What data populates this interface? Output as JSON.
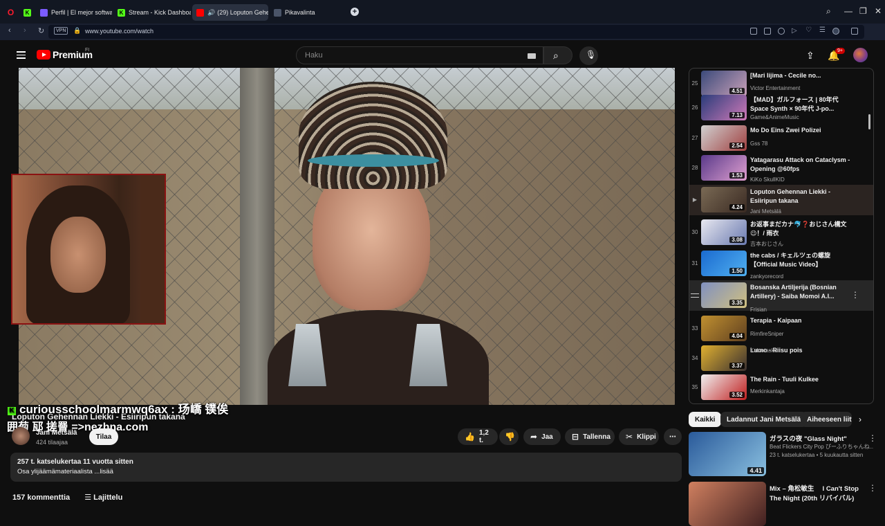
{
  "browser": {
    "tabs": [
      {
        "label": "",
        "fav_color": "#ff1b2d"
      },
      {
        "label": "",
        "fav_color": "#53fc18"
      },
      {
        "label": "Perfil | El mejor software p",
        "fav_color": "#7b5cff"
      },
      {
        "label": "Stream - Kick Dashboard",
        "fav_color": "#53fc18"
      },
      {
        "label": "(29) Loputon Gehenn",
        "fav_color": "#ff0000"
      },
      {
        "label": "Pikavalinta",
        "fav_color": "#8894a8"
      }
    ],
    "new_tab": "+",
    "url": "www.youtube.com/watch",
    "vpn": "VPN",
    "ai_label": "AI"
  },
  "youtube": {
    "brand": "Premium",
    "region": "FI",
    "search_placeholder": "Haku",
    "notif_count": "9+"
  },
  "overlay": {
    "chat_user": "curiousschoolmarmwq6ax",
    "chat_sep": " : ",
    "chat_text": "玚嶠 镤俟",
    "chat_line2": "囲菊 邷 搓罾 =>nezhna.com"
  },
  "video": {
    "title": "Loputon Gehennan Liekki - Esiiripun takana",
    "channel": "Jani Metsälä",
    "subscribers": "424 tilaajaa",
    "subscribe": "Tilaa",
    "likes": "1,2 t.",
    "share": "Jaa",
    "save": "Tallenna",
    "clip": "Klippi",
    "views_line": "257 t. katselukertaa  11 vuotta sitten",
    "desc_line": "Osa ylijäämämateriaalista ...lisää",
    "comments_label": "157 kommenttia",
    "sort_label": "Lajittelu"
  },
  "playlist": [
    {
      "idx": "25",
      "title": "[Mari Iijima - Cecile no...",
      "channel": "Victor Entertainment",
      "dur": "4.51",
      "colors": [
        "#3b4a7a",
        "#c9a0b8"
      ]
    },
    {
      "idx": "26",
      "title": "【MAD】ガルフォース | 80年代 Space Synth × 90年代 J-po...",
      "channel": "Game&AnimeMusic",
      "dur": "7.13",
      "colors": [
        "#2a3c7a",
        "#d07ab8"
      ]
    },
    {
      "idx": "27",
      "title": "Mo Do Eins Zwei Polizei",
      "channel": "Gss 78",
      "dur": "2.54",
      "colors": [
        "#d0d0d0",
        "#a04040"
      ]
    },
    {
      "idx": "28",
      "title": "Yatagarasu Attack on Cataclysm - Opening @60fps",
      "channel": "KiKo SkullKID",
      "dur": "1.53",
      "colors": [
        "#5a3a8a",
        "#e0a0d0"
      ]
    },
    {
      "idx": "▶",
      "title": "Loputon Gehennan Liekki - Esiiripun takana",
      "channel": "Jani Metsälä",
      "dur": "4.24",
      "colors": [
        "#7a6a55",
        "#3a2a22"
      ]
    },
    {
      "idx": "30",
      "title": "お返事まだカナ🐬❓おじさん構文😉！/ 雨衣",
      "channel": "吉本おじさん",
      "dur": "3.08",
      "colors": [
        "#e8e8f0",
        "#6a7ab0"
      ]
    },
    {
      "idx": "31",
      "title": "the cabs / キェルツェの螺旋【Official Music Video】",
      "channel": "zankyorecord",
      "dur": "1.50",
      "colors": [
        "#1a6ad0",
        "#50b0f0"
      ]
    },
    {
      "idx": "",
      "title": "Bosanska Artiljerija (Bosnian Artillery) - Saiba Momoi A.I...",
      "channel": "Frisian",
      "dur": "3.35",
      "colors": [
        "#8090c0",
        "#d0c080"
      ]
    },
    {
      "idx": "33",
      "title": "Terapia - Kaipaan",
      "channel": "RimfireSniper",
      "dur": "4.04",
      "colors": [
        "#c09030",
        "#604020"
      ]
    },
    {
      "idx": "34",
      "title": "Lumo - Riisu pois",
      "channel": "Kalvotasku",
      "dur": "3.37",
      "colors": [
        "#e0b030",
        "#3a3030"
      ]
    },
    {
      "idx": "35",
      "title": "The Rain - Tuuli Kulkee",
      "channel": "Merkinkantaja",
      "dur": "3.52",
      "colors": [
        "#f0f0f0",
        "#c02020"
      ]
    }
  ],
  "chips": [
    "Kaikki",
    "Ladannut Jani Metsälä",
    "Aiheeseen liitt"
  ],
  "recommendations": [
    {
      "title": "ガラスの夜 \"Glass Night\"",
      "channel": "Beat Flickers City Pop ぴーふりちゃんね...",
      "meta": "23 t. katselukertaa • 5 kuukautta sitten",
      "dur": "4.41",
      "colors": [
        "#2a5a9a",
        "#8ac0e0"
      ]
    },
    {
      "title": "Mix – 角松敏生 　I Can't Stop",
      "channel": "The Night (20th リバイバル)",
      "meta": "",
      "dur": "",
      "colors": [
        "#d08060",
        "#402020"
      ]
    }
  ],
  "colors": {
    "accent_red": "#ff0000",
    "kick_green": "#53fc18",
    "current_row": "#2b2421"
  }
}
